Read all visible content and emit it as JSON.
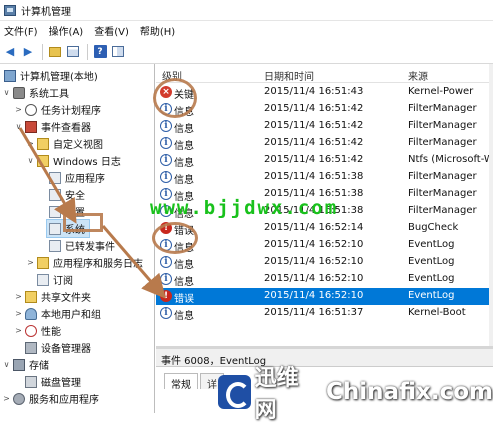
{
  "window": {
    "title": "计算机管理"
  },
  "menu": [
    "文件(F)",
    "操作(A)",
    "查看(V)",
    "帮助(H)"
  ],
  "tree": {
    "items": [
      {
        "label": "计算机管理(本地)"
      },
      {
        "label": "系统工具"
      },
      {
        "label": "任务计划程序"
      },
      {
        "label": "事件查看器"
      },
      {
        "label": "自定义视图"
      },
      {
        "label": "Windows 日志"
      },
      {
        "label": "应用程序"
      },
      {
        "label": "安全"
      },
      {
        "label": "设置"
      },
      {
        "label": "系统"
      },
      {
        "label": "已转发事件"
      },
      {
        "label": "应用程序和服务日志"
      },
      {
        "label": "订阅"
      },
      {
        "label": "共享文件夹"
      },
      {
        "label": "本地用户和组"
      },
      {
        "label": "性能"
      },
      {
        "label": "设备管理器"
      },
      {
        "label": "存储"
      },
      {
        "label": "磁盘管理"
      },
      {
        "label": "服务和应用程序"
      }
    ]
  },
  "events": {
    "columns": {
      "level": "级别",
      "datetime": "日期和时间",
      "source": "来源"
    },
    "rows": [
      {
        "level": "关键",
        "type": "critical",
        "datetime": "2015/11/4 16:51:43",
        "source": "Kernel-Power"
      },
      {
        "level": "信息",
        "type": "info",
        "datetime": "2015/11/4 16:51:42",
        "source": "FilterManager"
      },
      {
        "level": "信息",
        "type": "info",
        "datetime": "2015/11/4 16:51:42",
        "source": "FilterManager"
      },
      {
        "level": "信息",
        "type": "info",
        "datetime": "2015/11/4 16:51:42",
        "source": "FilterManager"
      },
      {
        "level": "信息",
        "type": "info",
        "datetime": "2015/11/4 16:51:42",
        "source": "Ntfs (Microsoft-W"
      },
      {
        "level": "信息",
        "type": "info",
        "datetime": "2015/11/4 16:51:38",
        "source": "FilterManager"
      },
      {
        "level": "信息",
        "type": "info",
        "datetime": "2015/11/4 16:51:38",
        "source": "FilterManager"
      },
      {
        "level": "信息",
        "type": "info",
        "datetime": "2015/11/4 16:51:38",
        "source": "FilterManager"
      },
      {
        "level": "错误",
        "type": "error",
        "datetime": "2015/11/4 16:52:14",
        "source": "BugCheck"
      },
      {
        "level": "信息",
        "type": "info",
        "datetime": "2015/11/4 16:52:10",
        "source": "EventLog"
      },
      {
        "level": "信息",
        "type": "info",
        "datetime": "2015/11/4 16:52:10",
        "source": "EventLog"
      },
      {
        "level": "信息",
        "type": "info",
        "datetime": "2015/11/4 16:52:10",
        "source": "EventLog"
      },
      {
        "level": "错误",
        "type": "error",
        "datetime": "2015/11/4 16:52:10",
        "source": "EventLog",
        "selected": true
      },
      {
        "level": "信息",
        "type": "info",
        "datetime": "2015/11/4 16:51:37",
        "source": "Kernel-Boot"
      }
    ]
  },
  "detail": {
    "title": "事件 6008，EventLog",
    "tabs": [
      "常规",
      "详"
    ]
  },
  "overlay": {
    "watermark": "www.bjjdwx.com",
    "brand_cn": "迅维网",
    "brand_en": "Chinafix.com"
  },
  "colors": {
    "highlight": "#b87a4c",
    "selection": "#0078d7",
    "watermark": "#19c11c"
  }
}
